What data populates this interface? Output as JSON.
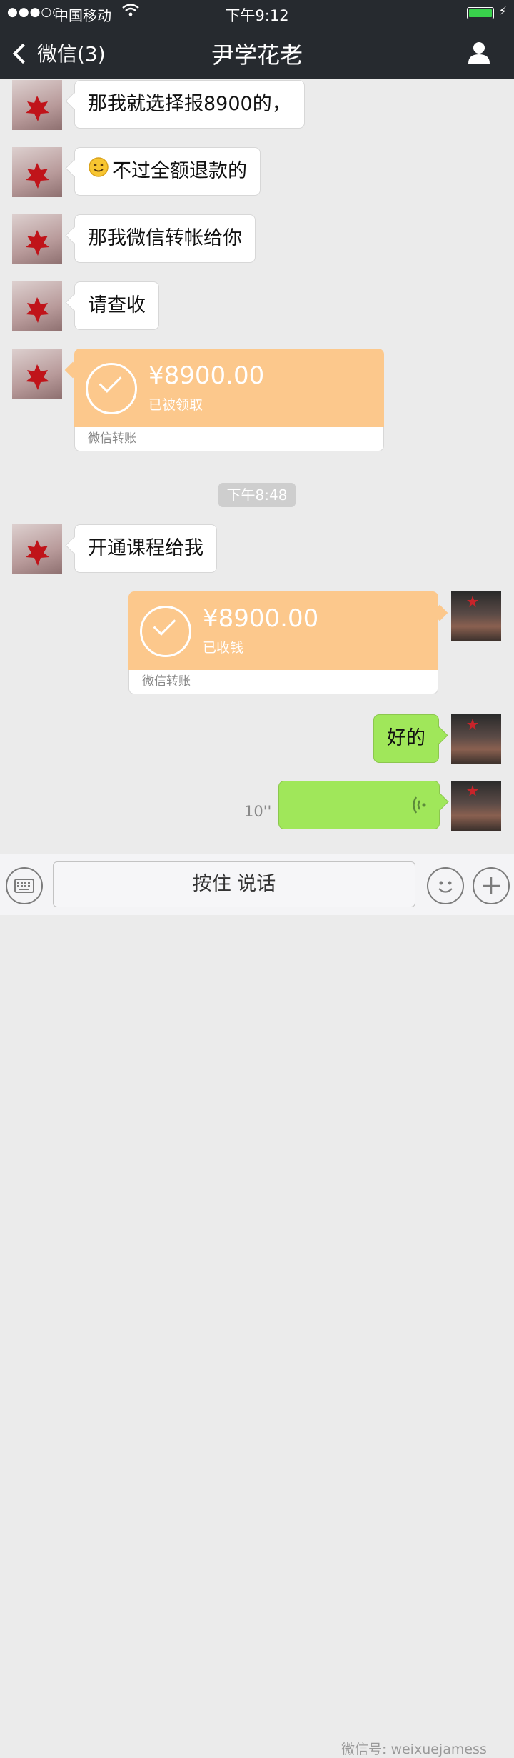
{
  "status_bar": {
    "signal": "●●●○○",
    "carrier": "中国移动",
    "time": "下午9:12"
  },
  "nav": {
    "back_label": "微信(3)",
    "title": "尹学花老"
  },
  "messages": {
    "m1": "那我就选择报8900的，",
    "m2": "不过全额退款的",
    "m3": "那我微信转帐给你",
    "m4": "请查收",
    "m5": "开通课程给我",
    "m6": "好的"
  },
  "transfer_in": {
    "amount": "¥8900.00",
    "status": "已被领取",
    "footer": "微信转账"
  },
  "transfer_out": {
    "amount": "¥8900.00",
    "status": "已收钱",
    "footer": "微信转账"
  },
  "timestamp": "下午8:48",
  "voice": {
    "duration": "10''"
  },
  "input_bar": {
    "talk_label": "按住 说话"
  },
  "watermark": "微信号: weixuejamess",
  "colors": {
    "header_bg": "#262a2f",
    "chat_bg": "#ebebeb",
    "sent_bubble": "#a0e75a",
    "transfer_orange": "#fcc88c"
  }
}
